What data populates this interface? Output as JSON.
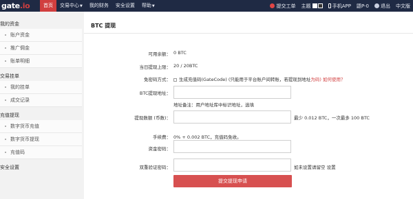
{
  "header": {
    "logo_text": "gate",
    "logo_dot": ".io",
    "nav": [
      {
        "label": "首页",
        "active": true,
        "caret": false
      },
      {
        "label": "交易中心",
        "active": false,
        "caret": true
      },
      {
        "label": "我的财务",
        "active": false,
        "caret": false
      },
      {
        "label": "安全设置",
        "active": false,
        "caret": false
      },
      {
        "label": "帮助",
        "active": false,
        "caret": true
      }
    ],
    "submit_ticket": "提交工单",
    "theme_label": "主题",
    "mobile_app": "手机APP",
    "username": "鼯P-0",
    "logout": "退出",
    "language": "中文版"
  },
  "sidebar": {
    "sections": [
      {
        "title": "我的资金",
        "items": [
          "账户资金",
          "推广佣金",
          "账单明细"
        ]
      },
      {
        "title": "交易挂单",
        "items": [
          "我的挂单",
          "成交记录"
        ]
      },
      {
        "title": "充值提现",
        "items": [
          "数字货币充值",
          "数字货币提现",
          "充值码"
        ]
      },
      {
        "title": "安全设置",
        "items": []
      }
    ]
  },
  "main": {
    "title": "BTC 提现",
    "available_label": "可用余额：",
    "available_value": "0 BTC",
    "daily_limit_label": "当日提现上限：",
    "daily_limit_value": "20 / 20BTC",
    "exempt_method_label": "免密码方式：",
    "exempt_method_text": "生成充值码(GateCode) (只能用于平台账户间转账，若提现到地址",
    "exempt_method_link": "如何使用？",
    "exempt_method_suffix_red": "为码)",
    "address_label": "BTC提现地址：",
    "address_value": "",
    "address_note": "地址备注：用户地址库中标识地址，选填",
    "amount_label": "提现数额 (币数)：",
    "amount_value": "",
    "amount_hint": "最少 0.012 BTC，一次最多 100 BTC",
    "fee_label": "手续费：",
    "fee_value": "0% + 0.002 BTC，充值码免收。",
    "fund_password_label": "资金密码：",
    "fund_password_value": "",
    "two_factor_label": "双重验证密码：",
    "two_factor_value": "",
    "two_factor_hint": "如未设置请留空 设置",
    "submit_label": "提交提现申请"
  },
  "colors": {
    "nav_bg": "#1f2a44",
    "accent_red": "#d13f3f",
    "submit_bg": "#d75050"
  }
}
